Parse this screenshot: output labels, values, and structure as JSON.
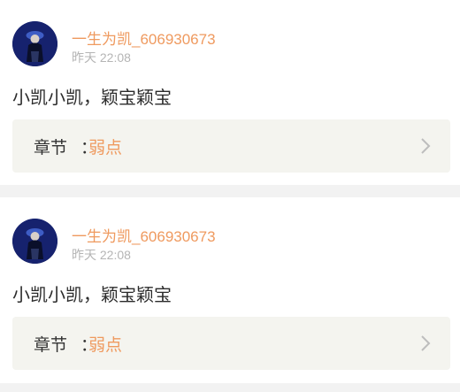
{
  "posts": [
    {
      "username": "一生为凯_606930673",
      "time": "昨天 22:08",
      "content": "小凯小凯，颖宝颖宝",
      "chapter_label": "章节",
      "chapter_sep": "：",
      "chapter_title": "弱点"
    },
    {
      "username": "一生为凯_606930673",
      "time": "昨天 22:08",
      "content": "小凯小凯，颖宝颖宝",
      "chapter_label": "章节",
      "chapter_sep": "：",
      "chapter_title": "弱点"
    }
  ],
  "colors": {
    "accent": "#ef9a5f",
    "muted": "#b5b5b5",
    "chapter_bg": "#f4f4ef",
    "page_bg": "#f2f2f2"
  },
  "icons": {
    "avatar": "user-avatar",
    "chevron": "chevron-right-icon"
  }
}
